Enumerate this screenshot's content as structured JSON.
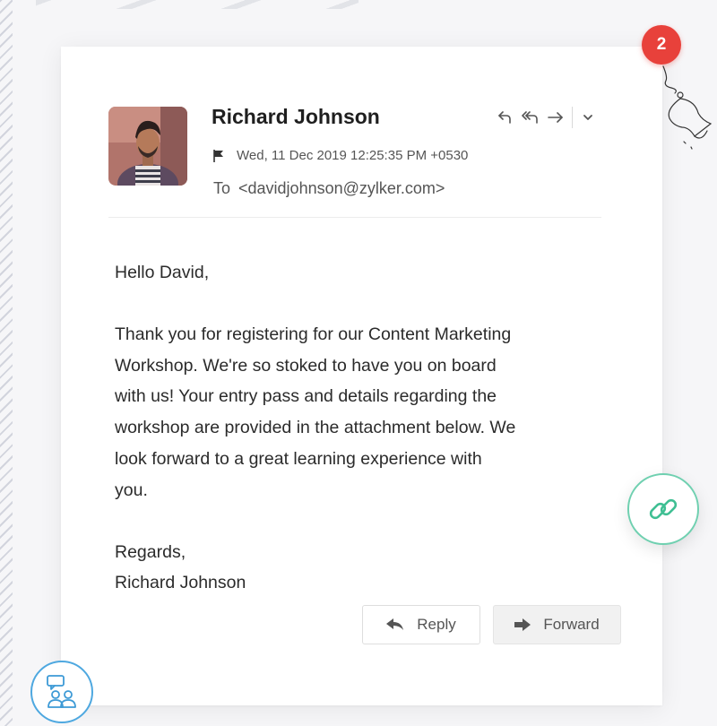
{
  "notification": {
    "count": "2"
  },
  "email": {
    "sender_name": "Richard Johnson",
    "date": "Wed, 11 Dec 2019 12:25:35 PM +0530",
    "to_label": "To",
    "to_address": "<davidjohnson@zylker.com>",
    "greeting": "Hello David,",
    "body_lines": [
      "Thank you for registering for our Content Marketing",
      "Workshop. We're so stoked to have you on board",
      "with us! Your entry pass and details regarding the",
      "workshop are provided in the attachment below. We",
      "look forward to a great learning experience with",
      "you."
    ],
    "closing": "Regards,",
    "signature": "Richard Johnson"
  },
  "actions": {
    "icons": [
      "reply-icon",
      "reply-all-icon",
      "forward-arrow-icon",
      "chevron-down-icon"
    ],
    "reply_label": "Reply",
    "forward_label": "Forward"
  },
  "colors": {
    "badge": "#e8413b",
    "link_ring": "#6fd0b0",
    "people_ring": "#4ea8e0"
  }
}
